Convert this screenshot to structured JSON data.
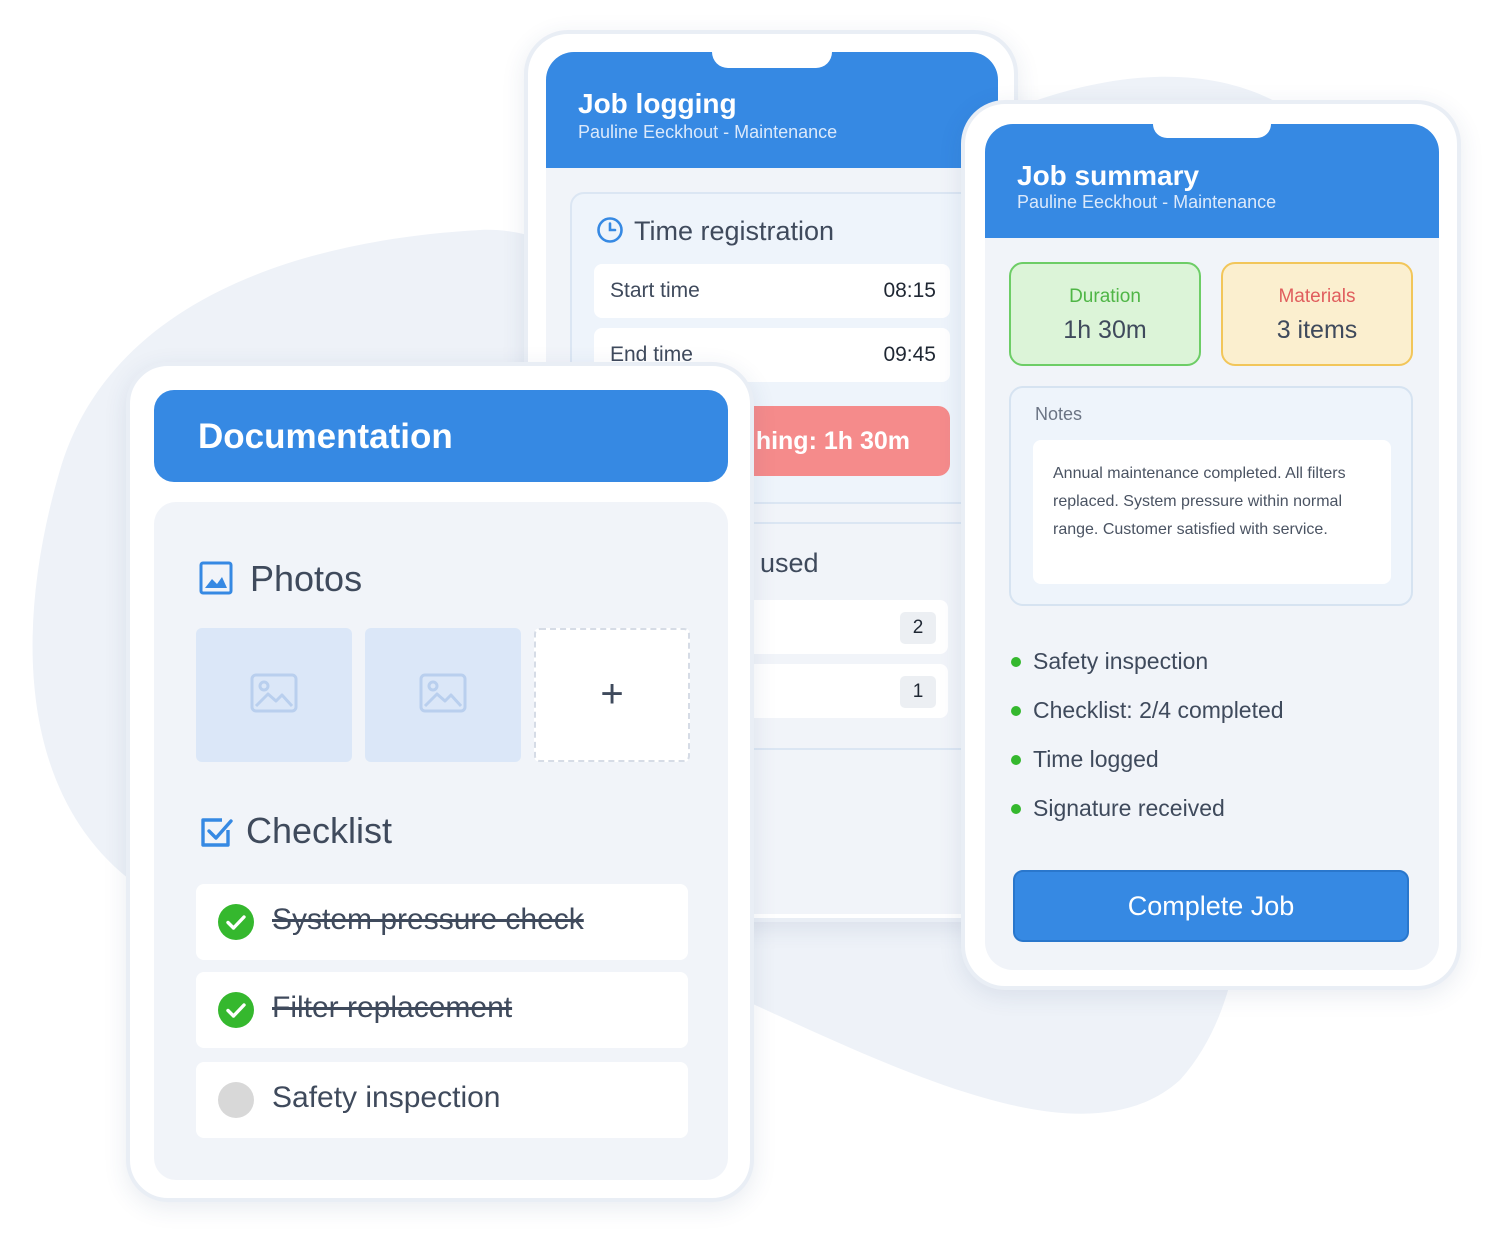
{
  "job_logging": {
    "title": "Job logging",
    "subtitle": "Pauline Eeckhout - Maintenance",
    "time_registration": {
      "title": "Time registration",
      "icon": "clock-icon",
      "start_label": "Start time",
      "start_value": "08:15",
      "end_label": "End time",
      "end_value": "09:45",
      "total_visible": "hing: 1h 30m"
    },
    "materials": {
      "title_visible": "used",
      "quantities": [
        "2",
        "1"
      ]
    }
  },
  "documentation": {
    "title": "Documentation",
    "photos": {
      "title": "Photos",
      "icon": "image-icon",
      "add_label": "+"
    },
    "checklist": {
      "title": "Checklist",
      "icon": "checkbox-icon",
      "items": [
        {
          "label": "System pressure check",
          "done": true
        },
        {
          "label": "Filter replacement",
          "done": true
        },
        {
          "label": "Safety inspection",
          "done": false
        }
      ]
    }
  },
  "job_summary": {
    "title": "Job summary",
    "subtitle": "Pauline Eeckhout - Maintenance",
    "duration_label": "Duration",
    "duration_value": "1h 30m",
    "materials_label": "Materials",
    "materials_value": "3 items",
    "notes_label": "Notes",
    "notes_text": "Annual maintenance completed. All filters replaced. System pressure within normal range. Customer satisfied with service.",
    "summary_items": [
      "Safety inspection",
      "Checklist: 2/4 completed",
      "Time logged",
      "Signature received"
    ],
    "complete_button": "Complete Job"
  },
  "colors": {
    "primary": "#3689e3",
    "success": "#35b82e",
    "danger_pill": "#f58b8b",
    "background_blob": "#eef2f8"
  }
}
